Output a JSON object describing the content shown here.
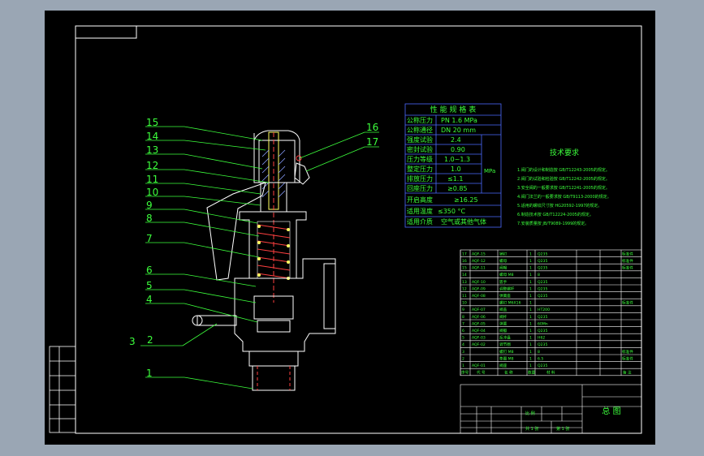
{
  "part_labels": [
    "15",
    "14",
    "13",
    "12",
    "11",
    "10",
    "9",
    "8",
    "7",
    "6",
    "5",
    "4",
    "3",
    "2",
    "1",
    "16",
    "17"
  ],
  "perf_table": {
    "title": "性 能 规 格 表",
    "rows": [
      {
        "label": "公称压力",
        "value": "PN   1.6 MPa"
      },
      {
        "label": "公称通径",
        "value": "DN   20 mm"
      },
      {
        "label": "强度试验",
        "value": "2.4"
      },
      {
        "label": "密封试验",
        "value": "0.90"
      },
      {
        "label": "压力等级",
        "value": "1.0~1.3"
      },
      {
        "label": "整定压力",
        "value": "1.0"
      },
      {
        "label": "排放压力",
        "value": "≤1.1"
      },
      {
        "label": "回座压力",
        "value": "≥0.85"
      },
      {
        "label": "开启高度",
        "value": "≥16.25"
      },
      {
        "label": "适用温度",
        "value": "≤350 °C"
      },
      {
        "label": "适用介质",
        "value": "空气或其他气体"
      }
    ],
    "unit": "MPa"
  },
  "tech_req": {
    "title": "技术要求",
    "lines": [
      "1.阀门的设计和制造按 GB/T12243-2005的规定。",
      "2.阀门的试验和检验按 GB/T12242-2005的规定。",
      "3.安全阀的一般要求按 GB/T12241-2005的规定。",
      "4.阀门法兰的一般要求按 GB/T9113-2000的规定。",
      "5.适用的螺纹尺寸按 HG20592-1997的规定。",
      "6.制造技术按 GB/T12224-2005的规定。",
      "7.安装质量按 JB/T9089-1999的规定。"
    ]
  },
  "bom_rows": [
    {
      "no": "17",
      "code": "AQF-15",
      "name": "销钉",
      "qty": "1",
      "mat": "Q235",
      "note": "标准件"
    },
    {
      "no": "16",
      "code": "AQF-12",
      "name": "螺母",
      "qty": "1",
      "mat": "Q235",
      "note": "标准件"
    },
    {
      "no": "15",
      "code": "AQF-11",
      "name": "阀帽",
      "qty": "1",
      "mat": "Q235",
      "note": "标准件"
    },
    {
      "no": "14",
      "code": "",
      "name": "螺母 M8",
      "qty": "1",
      "mat": "8",
      "note": ""
    },
    {
      "no": "13",
      "code": "AQF-10",
      "name": "扳手",
      "qty": "1",
      "mat": "Q235",
      "note": ""
    },
    {
      "no": "12",
      "code": "AQF-09",
      "name": "调整螺杆",
      "qty": "1",
      "mat": "Q235",
      "note": ""
    },
    {
      "no": "11",
      "code": "AQF-08",
      "name": "弹簧座",
      "qty": "1",
      "mat": "Q235",
      "note": ""
    },
    {
      "no": "10",
      "code": "",
      "name": "螺钉 M6X16",
      "qty": "1",
      "mat": "",
      "note": "标准件"
    },
    {
      "no": "9",
      "code": "AQF-07",
      "name": "阀盖",
      "qty": "1",
      "mat": "HT200",
      "note": ""
    },
    {
      "no": "8",
      "code": "AQF-06",
      "name": "阀杆",
      "qty": "1",
      "mat": "Q235",
      "note": ""
    },
    {
      "no": "7",
      "code": "AQF-05",
      "name": "弹簧",
      "qty": "1",
      "mat": "60Mn",
      "note": ""
    },
    {
      "no": "6",
      "code": "AQF-04",
      "name": "阀瓣",
      "qty": "1",
      "mat": "Q235",
      "note": ""
    },
    {
      "no": "5",
      "code": "AQF-03",
      "name": "反冲盘",
      "qty": "1",
      "mat": "H62",
      "note": ""
    },
    {
      "no": "4",
      "code": "AQF-02",
      "name": "调节圈",
      "qty": "1",
      "mat": "Q235",
      "note": ""
    },
    {
      "no": "3",
      "code": "",
      "name": "螺钉 M8",
      "qty": "1",
      "mat": "8",
      "note": "标准件"
    },
    {
      "no": "2",
      "code": "",
      "name": "垫圈 M8",
      "qty": "1",
      "mat": "6.5",
      "note": "标准件"
    },
    {
      "no": "1",
      "code": "AQF-01",
      "name": "阀座",
      "qty": "1",
      "mat": "Q235",
      "note": ""
    }
  ],
  "bom_header": {
    "no": "序号",
    "code": "代 号",
    "name": "名 称",
    "qty": "数量",
    "mat": "材 料",
    "note": "备 注"
  },
  "title_block": {
    "drawing_title": "总 图",
    "scale_label": "比 例",
    "sheet": "共 1 张",
    "page": "第 1 张"
  },
  "colors": {
    "line_green": "#3cff3c",
    "frame_white": "#ffffff",
    "spring_red": "#ff4040",
    "part_blue": "#8aa0ff",
    "part_yellow": "#ffff60"
  }
}
